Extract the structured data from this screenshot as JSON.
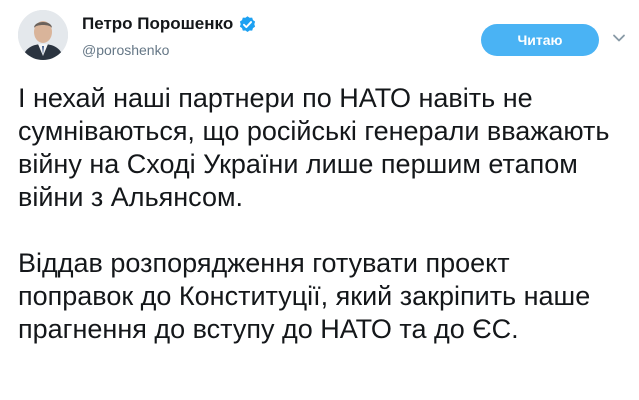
{
  "user": {
    "display_name": "Петро Порошенко",
    "handle": "@poroshenko"
  },
  "follow_button": {
    "label": "Читаю"
  },
  "tweet": {
    "paragraphs": [
      "І нехай наші партнери по НАТО навіть не сумніваються, що російські генерали вважають війну на Сході України лише першим етапом війни з Альянсом.",
      "Віддав розпорядження готувати проект поправок до Конституції, який закріпить наше прагнення до вступу до НАТО та до ЄС."
    ]
  },
  "colors": {
    "accent": "#4ab3f4",
    "verified": "#1da1f2",
    "handle": "#657786",
    "text": "#14171a"
  },
  "icons": {
    "verified": "verified-badge-icon",
    "menu": "chevron-down-icon"
  }
}
